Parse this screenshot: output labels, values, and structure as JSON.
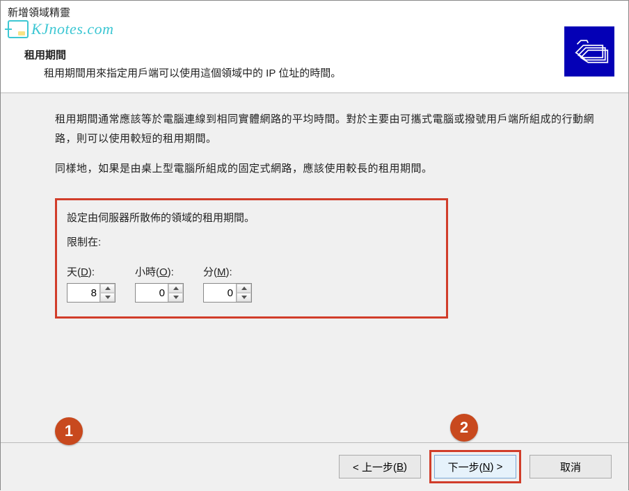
{
  "watermark": "KJnotes.com",
  "titlebar": "新增領域精靈",
  "header": {
    "title": "租用期間",
    "subtitle": "租用期間用來指定用戶端可以使用這個領域中的 IP 位址的時間。"
  },
  "body": {
    "para1": "租用期間通常應該等於電腦連線到相同實體網路的平均時間。對於主要由可攜式電腦或撥號用戶端所組成的行動網路，則可以使用較短的租用期間。",
    "para2": "同樣地，如果是由桌上型電腦所組成的固定式網路，應該使用較長的租用期間。",
    "setting_label": "設定由伺服器所散佈的領域的租用期間。",
    "limit_label": "限制在:",
    "days": {
      "label_prefix": "天(",
      "label_key": "D",
      "label_suffix": "):",
      "value": "8"
    },
    "hours": {
      "label_prefix": "小時(",
      "label_key": "O",
      "label_suffix": "):",
      "value": "0"
    },
    "minutes": {
      "label_prefix": "分(",
      "label_key": "M",
      "label_suffix": "):",
      "value": "0"
    }
  },
  "callouts": {
    "one": "1",
    "two": "2"
  },
  "footer": {
    "back_prefix": "< 上一步(",
    "back_key": "B",
    "back_suffix": ")",
    "next_prefix": "下一步(",
    "next_key": "N",
    "next_suffix": ") >",
    "cancel": "取消"
  }
}
